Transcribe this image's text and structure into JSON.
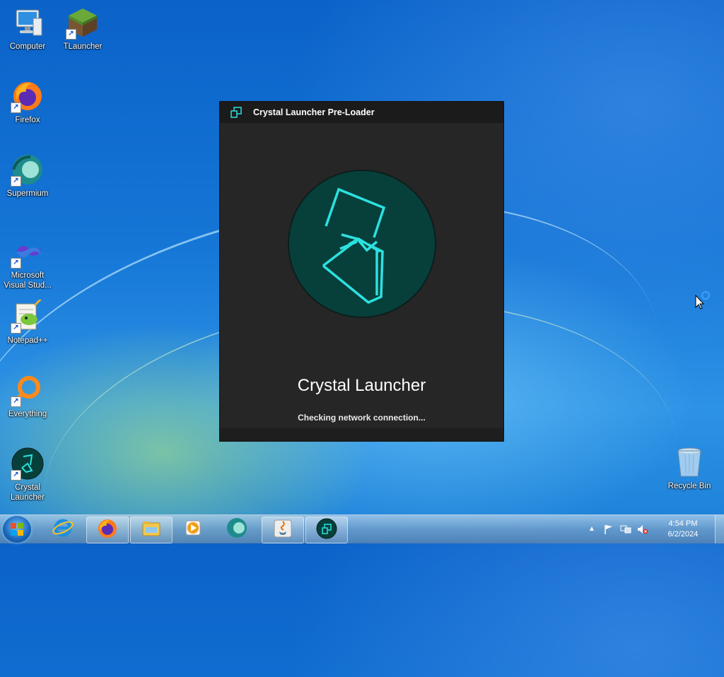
{
  "desktop": {
    "icons": [
      {
        "label": "Computer",
        "icon": "computer-icon"
      },
      {
        "label": "TLauncher",
        "icon": "minecraft-grass-block-icon"
      },
      {
        "label": "Firefox",
        "icon": "firefox-icon"
      },
      {
        "label": "Supermium",
        "icon": "supermium-icon"
      },
      {
        "label": "Microsoft Visual Stud...",
        "icon": "visual-studio-icon"
      },
      {
        "label": "Notepad++",
        "icon": "notepad-plus-plus-icon"
      },
      {
        "label": "Everything",
        "icon": "everything-search-icon"
      },
      {
        "label": "Crystal Launcher",
        "icon": "crystal-launcher-icon"
      },
      {
        "label": "Recycle Bin",
        "icon": "recycle-bin-icon"
      }
    ]
  },
  "window": {
    "title": "Crystal Launcher Pre-Loader",
    "app_name": "Crystal Launcher",
    "status": "Checking network connection...",
    "accent": "#2de0e0",
    "background": "#262626",
    "circle_color": "#07403b"
  },
  "taskbar": {
    "items": [
      "start-button",
      "internet-explorer-icon",
      "firefox-icon",
      "file-explorer-icon",
      "media-player-icon",
      "supermium-icon",
      "java-icon",
      "crystal-launcher-icon"
    ],
    "clock": {
      "time": "4:54 PM",
      "date": "6/2/2024"
    }
  }
}
